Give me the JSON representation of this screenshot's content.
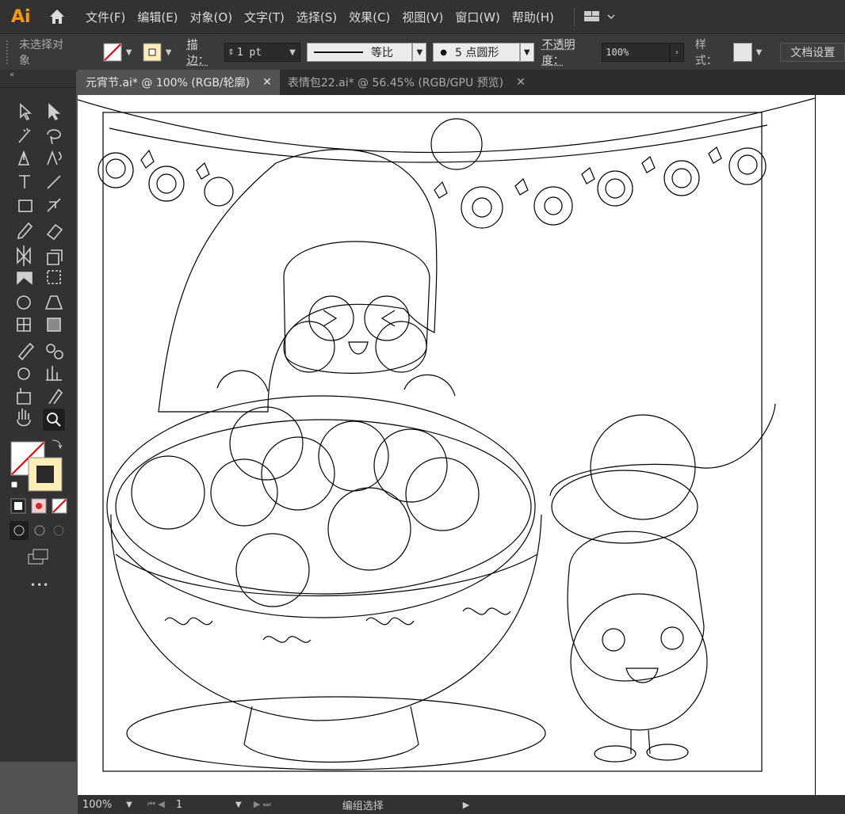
{
  "app": {
    "logo": "Ai"
  },
  "menu": [
    "文件(F)",
    "编辑(E)",
    "对象(O)",
    "文字(T)",
    "选择(S)",
    "效果(C)",
    "视图(V)",
    "窗口(W)",
    "帮助(H)"
  ],
  "control": {
    "selection_status": "未选择对象",
    "stroke_label": "描边：",
    "stroke_weight": "1 pt",
    "profile_label": "等比",
    "brush_label": "5 点圆形",
    "brush_dot": "●",
    "opacity_label": "不透明度：",
    "opacity_value": "100%",
    "style_label": "样式：",
    "doc_settings": "文档设置"
  },
  "tabs": [
    {
      "label": "元宵节.ai* @ 100% (RGB/轮廓)",
      "close": "✕",
      "active": true
    },
    {
      "label": "表情包22.ai* @ 56.45% (RGB/GPU 预览)",
      "close": "✕",
      "active": false
    }
  ],
  "tools_panel": {
    "collapse": "«",
    "more": "•••"
  },
  "status": {
    "zoom": "100%",
    "artboard": "1",
    "tool_status": "编组选择"
  },
  "colors": {
    "fill": "#ffeeb8",
    "stroke": "none",
    "brand": "#ff9a00"
  }
}
